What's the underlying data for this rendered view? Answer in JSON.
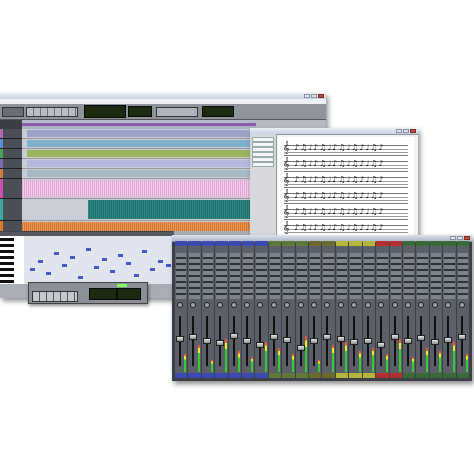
{
  "edit_window": {
    "title": "",
    "menu_items": [
      "",
      "",
      "",
      "",
      "",
      "",
      "",
      "",
      "",
      "",
      "",
      "",
      ""
    ],
    "tracks": [
      {
        "color": "#b06ab3",
        "lane": "#9aa4c6",
        "height": 6
      },
      {
        "color": "#5a8fd6",
        "lane": "#7fb0c9",
        "height": 6
      },
      {
        "color": "#46a35a",
        "lane": "#9ab55e",
        "height": 6
      },
      {
        "color": "#7c6ab3",
        "lane": "#b7b9dc",
        "height": 6
      },
      {
        "color": "#d47c3a",
        "lane": "#a6b8c4",
        "height": 6
      },
      {
        "color": "#cd4fae",
        "lane": "#e4a6d4",
        "height": 16
      },
      {
        "color": "#3fa6a2",
        "lane": "#2f8a86",
        "height": 18
      },
      {
        "color": "#d97a2a",
        "lane": "#d9722b",
        "height": 26
      }
    ]
  },
  "score_window": {
    "title": "",
    "staves": 6
  },
  "mix_window": {
    "title": "",
    "strip_colors": [
      "#3b4bb0",
      "#3b4bb0",
      "#3b4bb0",
      "#3b4bb0",
      "#3b4bb0",
      "#3b4bb0",
      "#3b4bb0",
      "#5d7a3a",
      "#5d7a3a",
      "#5d7a3a",
      "#6b6b2e",
      "#6b6b2e",
      "#b5b53a",
      "#b5b53a",
      "#b5b53a",
      "#b43030",
      "#b43030",
      "#3a6a3a",
      "#3a6a3a",
      "#3a6a3a",
      "#3a6a3a",
      "#3a6a3a"
    ],
    "fader_levels": [
      0.55,
      0.6,
      0.5,
      0.45,
      0.62,
      0.5,
      0.4,
      0.58,
      0.52,
      0.35,
      0.5,
      0.6,
      0.55,
      0.47,
      0.5,
      0.42,
      0.6,
      0.5,
      0.56,
      0.48,
      0.52,
      0.6
    ],
    "meter_levels": [
      0.3,
      0.45,
      0.2,
      0.55,
      0.35,
      0.25,
      0.5,
      0.4,
      0.3,
      0.6,
      0.2,
      0.45,
      0.5,
      0.35,
      0.4,
      0.3,
      0.55,
      0.25,
      0.4,
      0.35,
      0.5,
      0.3
    ]
  },
  "colors": {
    "counter_text": "#7dff5a",
    "window_chrome": "#c8d2e2"
  }
}
